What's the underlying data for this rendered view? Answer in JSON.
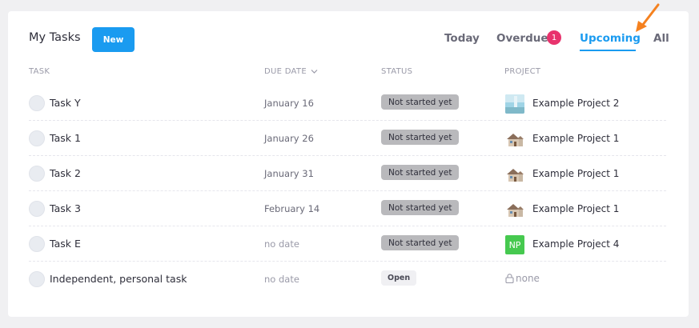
{
  "header": {
    "title": "My Tasks",
    "new_label": "New",
    "tabs": {
      "today": "Today",
      "overdue": "Overdue",
      "overdue_count": "1",
      "upcoming": "Upcoming",
      "all": "All"
    },
    "active_tab": "Upcoming"
  },
  "columns": {
    "task": "TASK",
    "due": "DUE DATE",
    "status": "STATUS",
    "project": "PROJECT"
  },
  "rows": [
    {
      "task": "Task Y",
      "due": "January 16",
      "status": "Not started yet",
      "project": "Example Project 2",
      "icon": "sky-thumbnail-icon"
    },
    {
      "task": "Task 1",
      "due": "January 26",
      "status": "Not started yet",
      "project": "Example Project 1",
      "icon": "house-icon"
    },
    {
      "task": "Task 2",
      "due": "January 31",
      "status": "Not started yet",
      "project": "Example Project 1",
      "icon": "house-icon"
    },
    {
      "task": "Task 3",
      "due": "February 14",
      "status": "Not started yet",
      "project": "Example Project 1",
      "icon": "house-icon"
    },
    {
      "task": "Task E",
      "due": "no date",
      "status": "Not started yet",
      "project": "Example Project 4",
      "icon": "np-avatar-icon",
      "icon_text": "NP"
    },
    {
      "task": "Independent, personal task",
      "due": "no date",
      "status": "Open",
      "project": "none",
      "icon": "lock-icon"
    }
  ],
  "colors": {
    "accent": "#1a9bf0",
    "badge": "#e8336d",
    "status_gray": "#b9b9bc",
    "np_green": "#46c94f",
    "annotation_arrow": "#f5811f"
  }
}
